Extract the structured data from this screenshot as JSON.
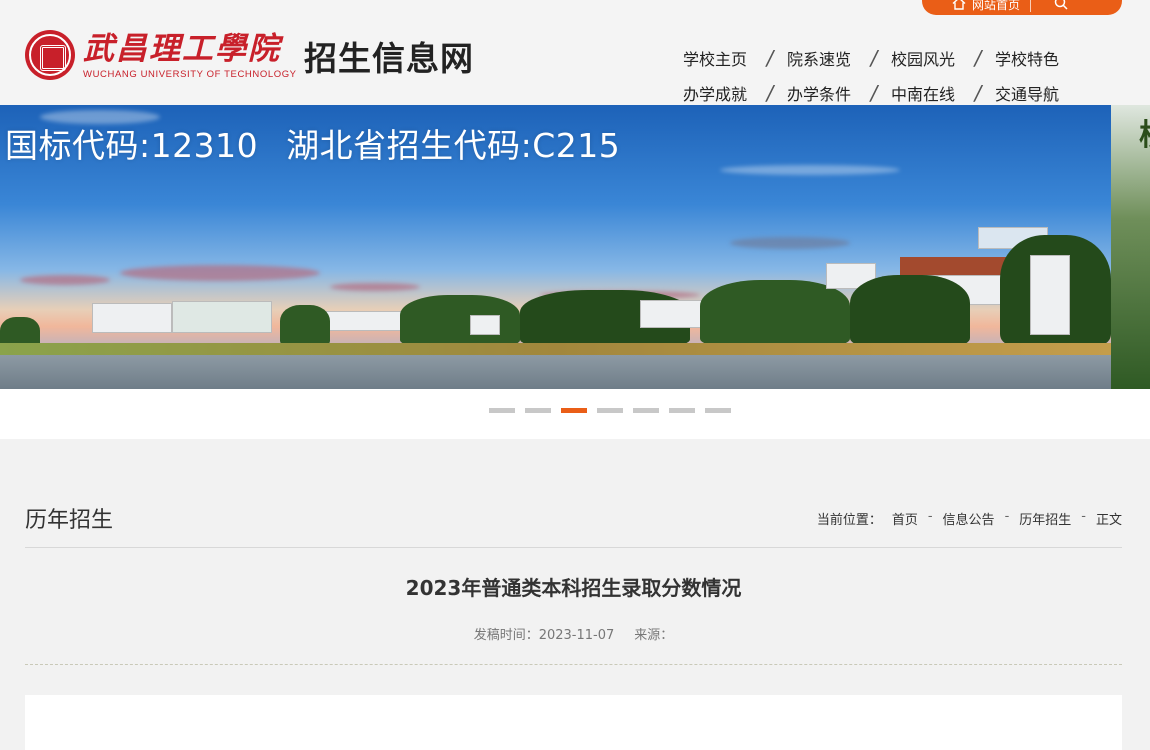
{
  "header": {
    "top_links": {
      "home_label": "网站首页"
    },
    "logo": {
      "cn": "武昌理工學院",
      "en": "WUCHANG UNIVERSITY OF TECHNOLOGY"
    },
    "site_name": "招生信息网",
    "nav": {
      "row1": [
        "学校主页",
        "院系速览",
        "校园风光",
        "学校特色"
      ],
      "row2": [
        "办学成就",
        "办学条件",
        "中南在线",
        "交通导航"
      ]
    }
  },
  "banner": {
    "codes": [
      "国标代码:12310",
      "湖北省招生代码:C215"
    ],
    "dot_count": 7,
    "active_dot": 3
  },
  "content": {
    "section_title": "历年招生",
    "breadcrumb": {
      "prefix": "当前位置：",
      "items": [
        "首页",
        "信息公告",
        "历年招生",
        "正文"
      ]
    },
    "article": {
      "title": "2023年普通类本科招生录取分数情况",
      "published_label": "发稿时间：2023-11-07",
      "source_label": "来源："
    }
  },
  "colors": {
    "accent": "#ea5e17",
    "brand_red": "#c8202a"
  }
}
